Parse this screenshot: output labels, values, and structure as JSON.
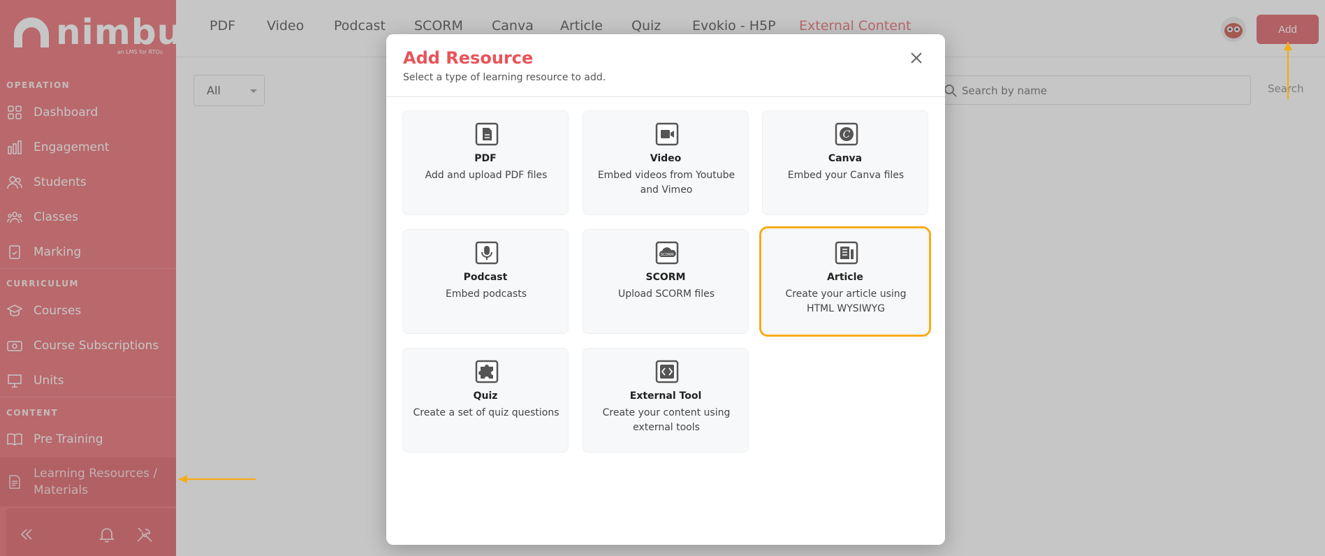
{
  "brand": {
    "name": "nimbu",
    "tagline": "an LMS for RTOs",
    "accent": "#e8545a",
    "highlight": "#f6ab17"
  },
  "sidebar": {
    "sections": {
      "operation": "OPERATION",
      "curriculum": "CURRICULUM",
      "content": "CONTENT"
    },
    "items": [
      {
        "label": "Dashboard",
        "icon": "grid-icon"
      },
      {
        "label": "Engagement",
        "icon": "bar-chart-icon"
      },
      {
        "label": "Students",
        "icon": "users-icon"
      },
      {
        "label": "Classes",
        "icon": "group-icon"
      },
      {
        "label": "Marking",
        "icon": "clipboard-check-icon"
      },
      {
        "label": "Courses",
        "icon": "graduation-cap-icon"
      },
      {
        "label": "Course Subscriptions",
        "icon": "money-icon"
      },
      {
        "label": "Units",
        "icon": "presentation-icon"
      },
      {
        "label": "Pre Training",
        "icon": "book-icon"
      },
      {
        "label": "Learning Resources / Materials",
        "icon": "document-icon",
        "active": true
      }
    ],
    "footer": {
      "collapse_icon": "double-chevron-left-icon",
      "bell_icon": "bell-icon",
      "tools_icon": "tools-icon"
    }
  },
  "topbar": {
    "tabs": [
      "PDF",
      "Video",
      "Podcast",
      "SCORM",
      "Canva",
      "Article",
      "Quiz",
      "Evokio - H5P",
      "External Content"
    ],
    "active_tab": "External Content",
    "add_button": "Add"
  },
  "filters": {
    "type_select": "All",
    "search_placeholder": "Search by name",
    "search_button": "Search"
  },
  "modal": {
    "title": "Add Resource",
    "subtitle": "Select a type of learning resource to add.",
    "cards": [
      {
        "title": "PDF",
        "desc": "Add and upload PDF files",
        "icon": "pdf-file-icon"
      },
      {
        "title": "Video",
        "desc": "Embed videos from Youtube and Vimeo",
        "icon": "video-camera-icon"
      },
      {
        "title": "Canva",
        "desc": "Embed your Canva files",
        "icon": "canva-icon"
      },
      {
        "title": "Podcast",
        "desc": "Embed podcasts",
        "icon": "microphone-icon"
      },
      {
        "title": "SCORM",
        "desc": "Upload SCORM files",
        "icon": "scorm-cloud-icon"
      },
      {
        "title": "Article",
        "desc": "Create your article using HTML WYSIWYG",
        "icon": "article-icon",
        "highlighted": true
      },
      {
        "title": "Quiz",
        "desc": "Create a set of quiz questions",
        "icon": "puzzle-icon"
      },
      {
        "title": "External Tool",
        "desc": "Create your content using external tools",
        "icon": "code-icon"
      }
    ]
  }
}
